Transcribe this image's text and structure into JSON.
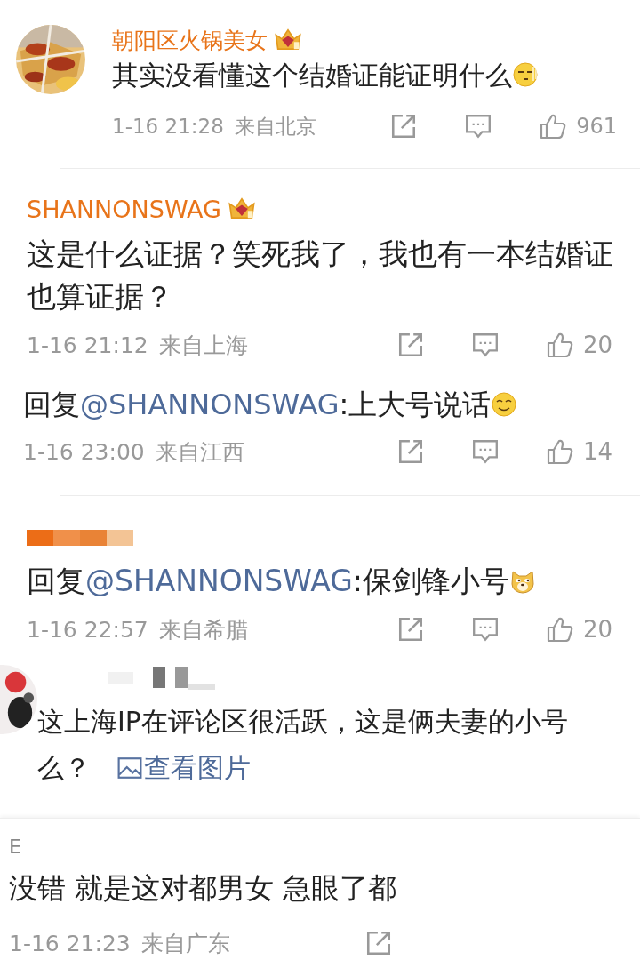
{
  "comments": [
    {
      "kind": "avatar",
      "masked": false,
      "name": "朝阳区火锅美女",
      "badge": true,
      "text": "其实没看懂这个结婚证能证明什么",
      "emoji": {
        "kind": "smirk"
      },
      "time": "1-16 21:28",
      "location": "来自北京",
      "actions": [
        {
          "kind": "share"
        },
        {
          "kind": "comment"
        },
        {
          "kind": "like",
          "count": "961"
        }
      ],
      "divider": true
    },
    {
      "kind": "plain",
      "masked": false,
      "name": "SHANNONSWAG",
      "badge": true,
      "text": "这是什么证据？笑死我了，我也有一本结婚证也算证据？",
      "time": "1-16 21:12",
      "location": "来自上海",
      "actions": [
        {
          "kind": "share"
        },
        {
          "kind": "comment"
        },
        {
          "kind": "like",
          "count": "20"
        }
      ],
      "divider": false
    },
    {
      "kind": "reply",
      "masked": false,
      "prefix": "回复",
      "mention": "@SHANNONSWAG",
      "text": ":上大号说话",
      "emoji": {
        "kind": "smile"
      },
      "time": "1-16 23:00",
      "location": "来自江西",
      "actions": [
        {
          "kind": "share"
        },
        {
          "kind": "comment"
        },
        {
          "kind": "like",
          "count": "14"
        }
      ],
      "divider": true
    },
    {
      "kind": "plain",
      "masked": true,
      "prefix": "回复",
      "mention": "@SHANNONSWAG",
      "text": ":保剑锋小号",
      "emoji": {
        "kind": "dog"
      },
      "time": "1-16 22:57",
      "location": "来自希腊",
      "actions": [
        {
          "kind": "share"
        },
        {
          "kind": "comment"
        },
        {
          "kind": "like",
          "count": "20"
        }
      ],
      "divider": false
    },
    {
      "kind": "overlap",
      "masked": true,
      "text": "这上海IP在评论区很活跃，这是俩夫妻的小号么？",
      "link": "查看图片",
      "divider": false
    },
    {
      "kind": "edge",
      "masked": false,
      "name": "E",
      "text": "没错 就是这对都男女 急眼了都",
      "time": "1-16 21:23",
      "location": "来自广东",
      "actions": [
        {
          "kind": "share"
        }
      ],
      "divider": false
    }
  ]
}
